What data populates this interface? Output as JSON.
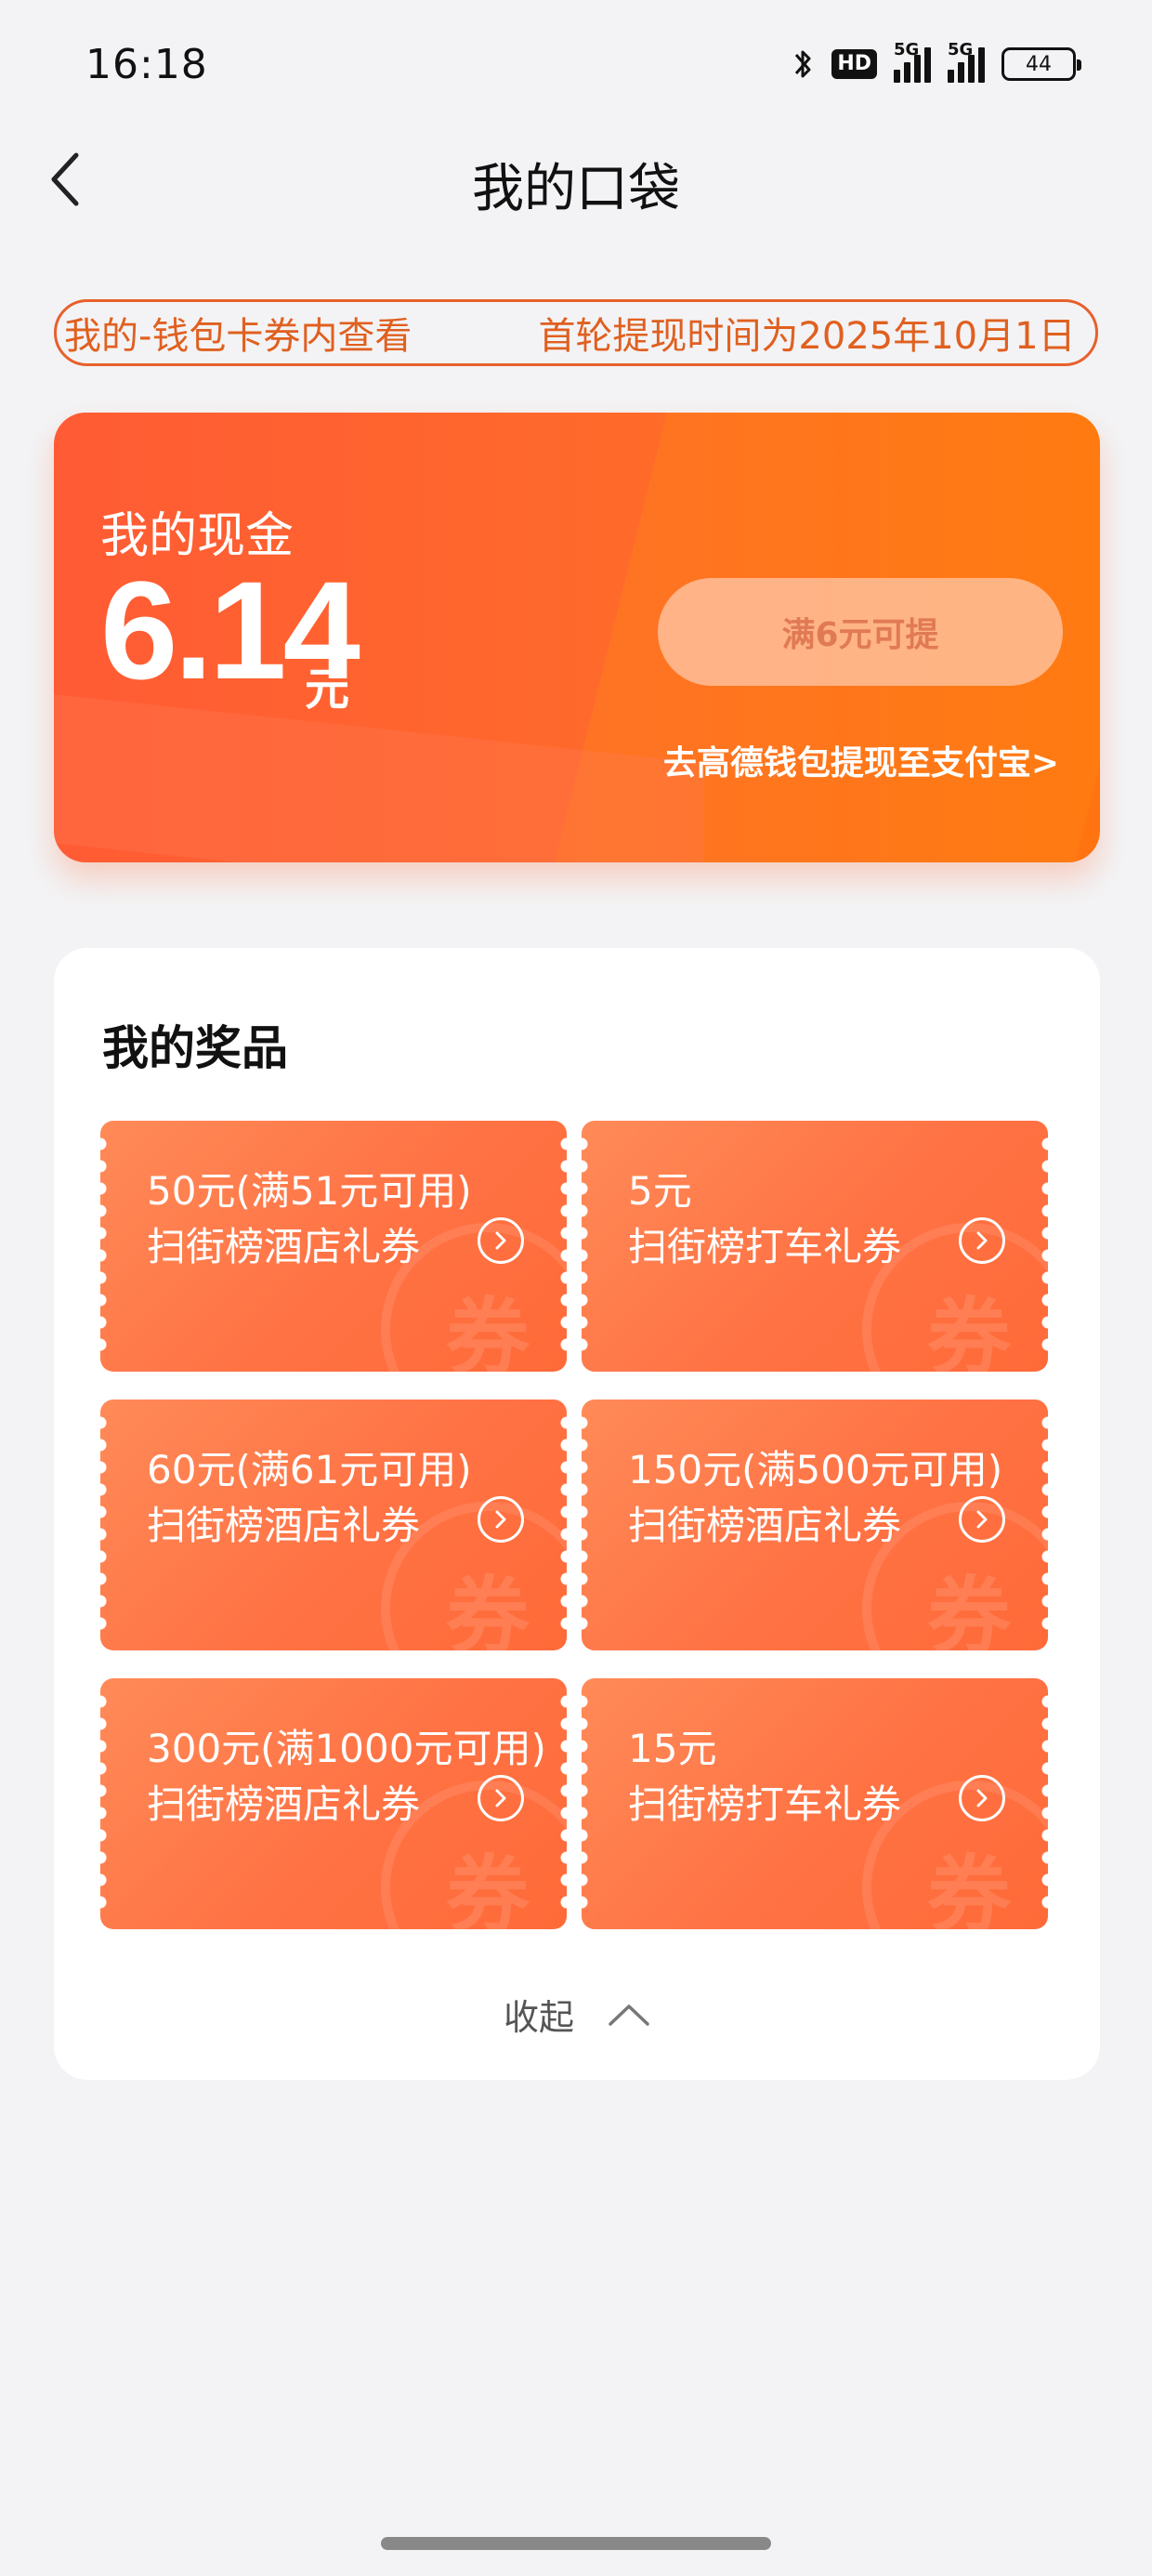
{
  "status_bar": {
    "time": "16:18",
    "hd_label": "HD",
    "sig1_label": "5G",
    "sig2_label": "5G",
    "battery": "44",
    "icons": [
      "bluetooth-icon",
      "hd-icon",
      "signal-icon",
      "signal-icon",
      "battery-icon"
    ]
  },
  "header": {
    "title": "我的口袋",
    "back_icon": "chevron-left-icon"
  },
  "notice": {
    "text_1": "我的-钱包卡券内查看",
    "text_2": "首轮提现时间为2025年10月1日"
  },
  "cash": {
    "label": "我的现金",
    "amount": "6.14",
    "unit": "元",
    "withdraw_button": "满6元可提",
    "wallet_link": "去高德钱包提现至支付宝>"
  },
  "prizes": {
    "title": "我的奖品",
    "stamp_text": "券",
    "items": [
      {
        "amount": "50元(满51元可用)",
        "name": "扫街榜酒店礼券"
      },
      {
        "amount": "5元",
        "name": "扫街榜打车礼券"
      },
      {
        "amount": "60元(满61元可用)",
        "name": "扫街榜酒店礼券"
      },
      {
        "amount": "150元(满500元可用)",
        "name": "扫街榜酒店礼券"
      },
      {
        "amount": "300元(满1000元可用)",
        "name": "扫街榜酒店礼券"
      },
      {
        "amount": "15元",
        "name": "扫街榜打车礼券"
      }
    ],
    "collapse_label": "收起"
  },
  "colors": {
    "accent": "#ff6a2a",
    "coupon": "#ff7a48",
    "background": "#f3f3f5"
  }
}
